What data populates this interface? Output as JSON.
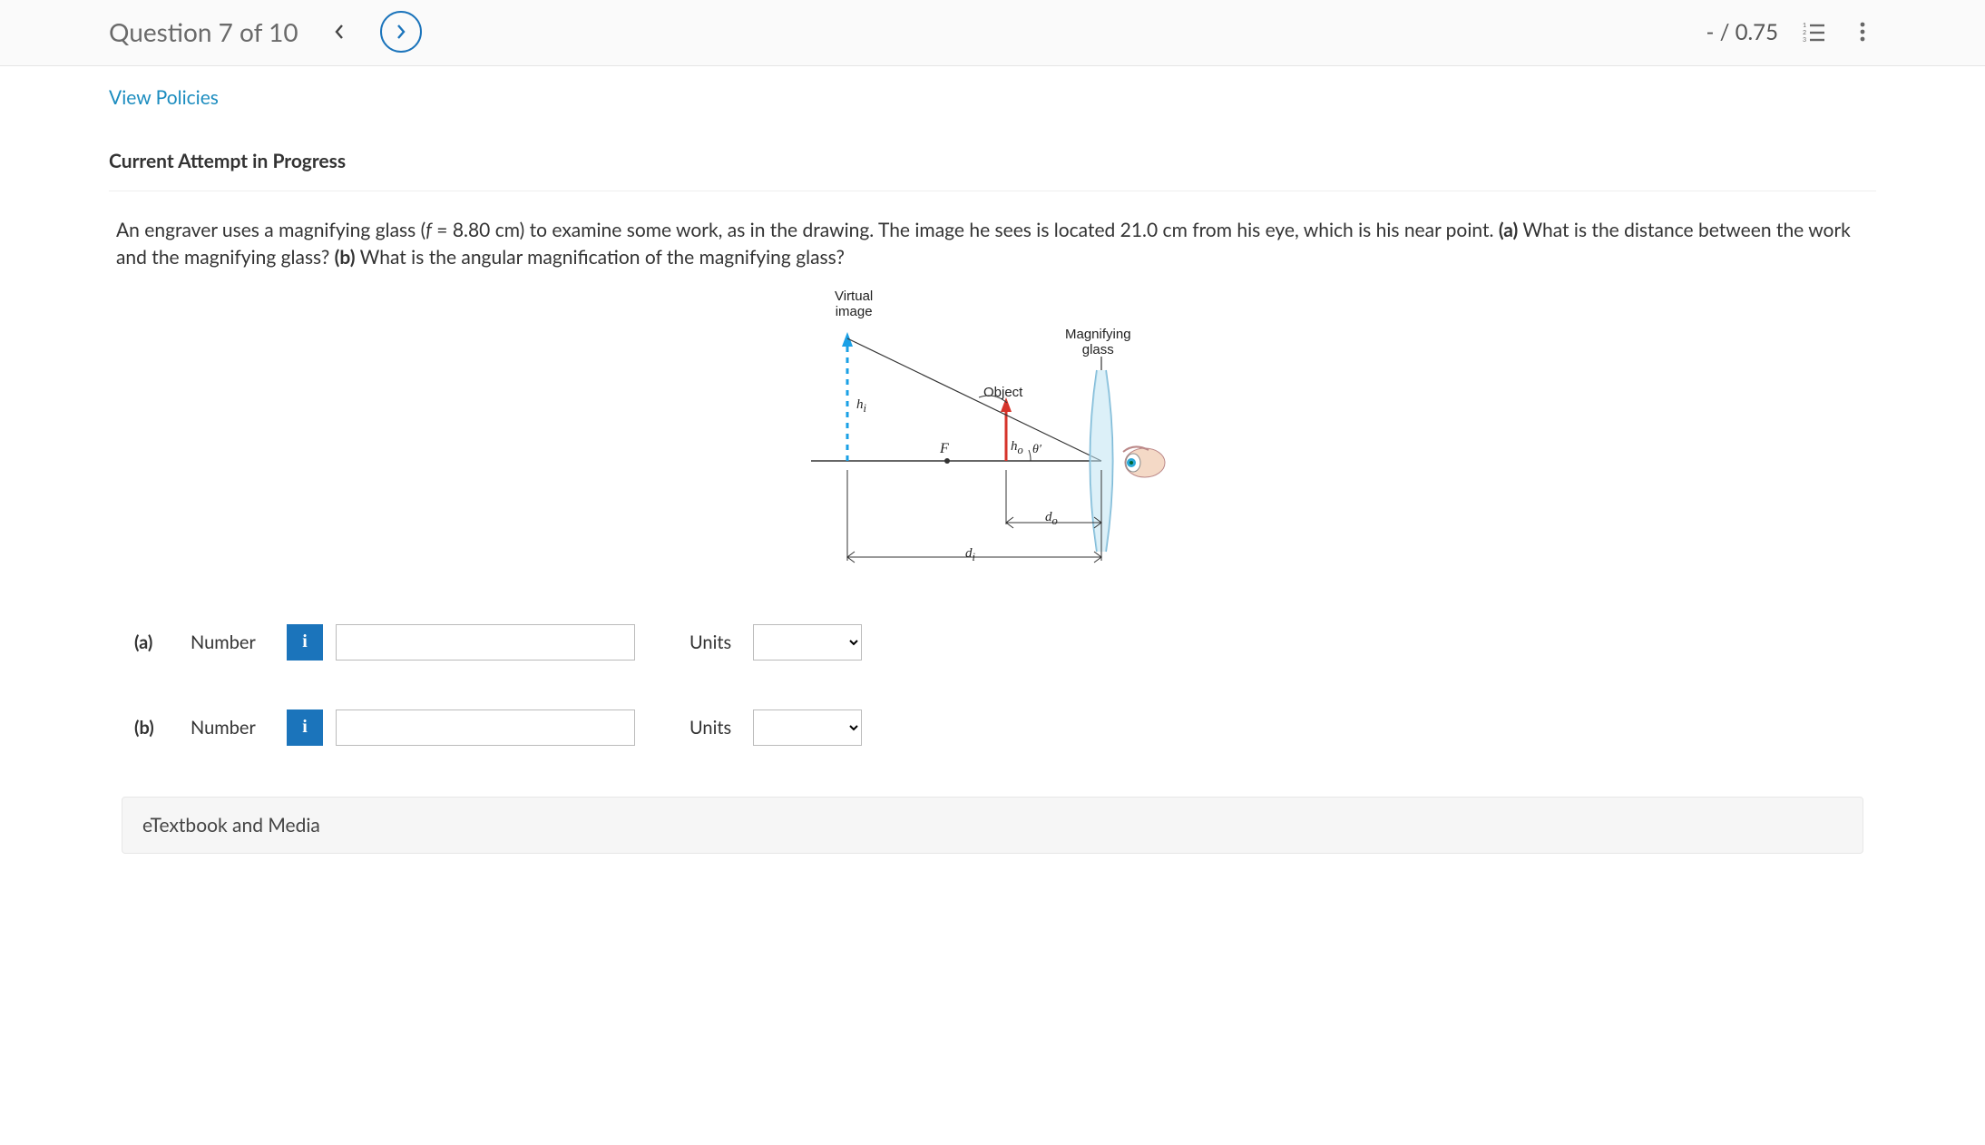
{
  "header": {
    "title": "Question 7 of 10",
    "score": "- / 0.75"
  },
  "links": {
    "view_policies": "View Policies",
    "attempt_heading": "Current Attempt in Progress",
    "etextbook": "eTextbook and Media"
  },
  "question": {
    "p1": "An engraver uses a magnifying glass (",
    "f_expr": "f",
    "p2": " = 8.80 cm) to examine some work, as in the drawing. The image he sees is located 21.0 cm from his eye, which is his near point. ",
    "a_label": "(a)",
    "p3": " What is the distance between the work and the magnifying glass? ",
    "b_label": "(b)",
    "p4": " What is the angular magnification of the magnifying glass?"
  },
  "diagram": {
    "virtual": "Virtual",
    "image": "image",
    "magnifying": "Magnifying",
    "glass": "glass",
    "object": "Object",
    "F": "F",
    "hi": "h",
    "hi_sub": "i",
    "ho": "h",
    "ho_sub": "o",
    "theta": "θ′",
    "di": "d",
    "di_sub": "i",
    "do": "d",
    "do_sub": "o"
  },
  "answers": {
    "a": {
      "part": "(a)",
      "label": "Number",
      "units_label": "Units"
    },
    "b": {
      "part": "(b)",
      "label": "Number",
      "units_label": "Units"
    }
  }
}
